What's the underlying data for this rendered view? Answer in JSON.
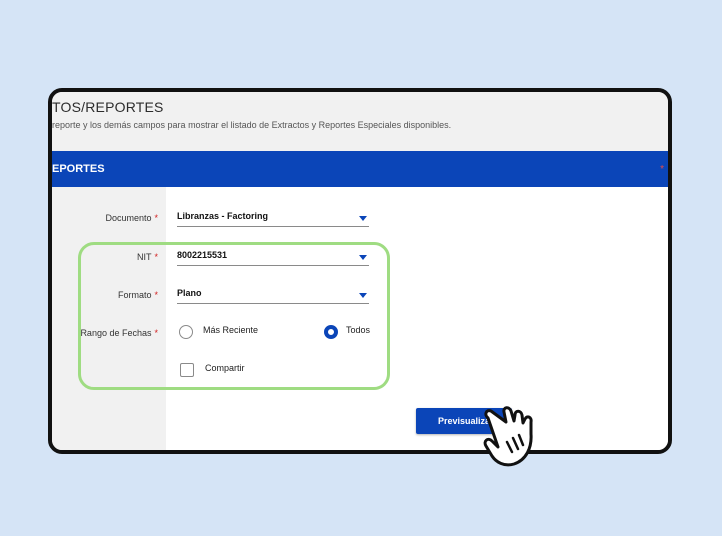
{
  "header": {
    "title": "TOS/REPORTES",
    "subtitle": "reporte y los demás campos para mostrar el listado de Extractos y Reportes Especiales disponibles."
  },
  "section": {
    "title": "EPORTES",
    "marker": "*"
  },
  "form": {
    "documento": {
      "label": "Documento",
      "required": "*",
      "value": "Libranzas - Factoring"
    },
    "nit": {
      "label": "NIT",
      "required": "*",
      "value": "8002215531"
    },
    "formato": {
      "label": "Formato",
      "required": "*",
      "value": "Plano"
    },
    "rango": {
      "label": "Rango de Fechas",
      "required": "*",
      "options": [
        {
          "label": "Más Reciente",
          "selected": false
        },
        {
          "label": "Todos",
          "selected": true
        }
      ]
    },
    "compartir": {
      "label": "Compartir",
      "checked": false
    }
  },
  "actions": {
    "preview_label": "Previsualizar"
  },
  "colors": {
    "primary": "#0b45b8",
    "required": "#d21f1f",
    "highlight": "#9fdc82",
    "background": "#d5e4f6"
  }
}
